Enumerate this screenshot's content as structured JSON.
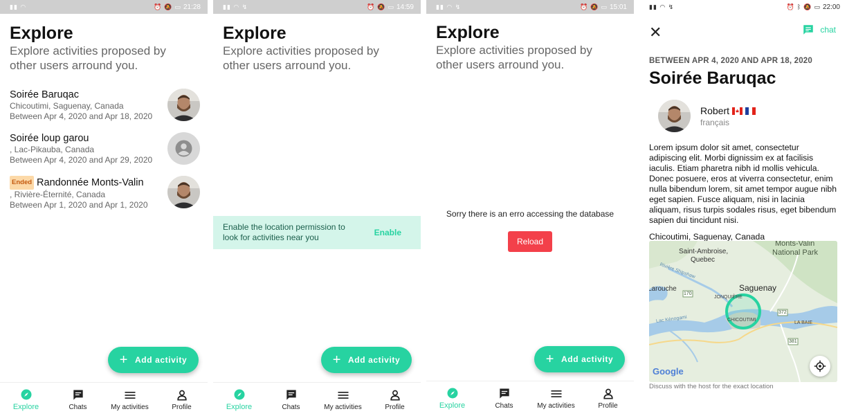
{
  "screens": [
    {
      "status_time": "21:28",
      "title": "Explore",
      "subtitle": "Explore activities proposed by other users arround you.",
      "activities": [
        {
          "name": "Soirée Baruqac",
          "location": "Chicoutimi, Saguenay, Canada",
          "dates": "Between Apr 4, 2020 and Apr 18, 2020",
          "avatar": "photo"
        },
        {
          "name": "Soirée loup garou",
          "location": ", Lac-Pikauba, Canada",
          "dates": "Between Apr 4, 2020 and Apr 29, 2020",
          "avatar": "placeholder"
        },
        {
          "badge": "Ended",
          "name": "Randonnée Monts-Valin",
          "location": ", Rivière-Éternité, Canada",
          "dates": "Between Apr 1, 2020 and Apr 1, 2020",
          "avatar": "photo"
        }
      ],
      "fab_label": "Add activity",
      "nav": [
        "Explore",
        "Chats",
        "My activities",
        "Profile"
      ]
    },
    {
      "status_time": "14:59",
      "title": "Explore",
      "subtitle": "Explore activities proposed by other users arround you.",
      "banner_text": "Enable the location permission to look for activities near you",
      "banner_action": "Enable",
      "fab_label": "Add activity",
      "nav": [
        "Explore",
        "Chats",
        "My activities",
        "Profile"
      ]
    },
    {
      "status_time": "15:01",
      "title": "Explore",
      "subtitle": "Explore activities proposed by other users arround you.",
      "error_text": "Sorry there is an erro accessing the database",
      "reload_label": "Reload",
      "fab_label": "Add activity",
      "nav": [
        "Explore",
        "Chats",
        "My activities",
        "Profile"
      ]
    },
    {
      "status_time": "22:00",
      "chat_label": "chat",
      "date_range": "BETWEEN APR 4, 2020 AND APR 18, 2020",
      "event_title": "Soirée Baruqac",
      "host_name": "Robert",
      "host_language": "français",
      "description": "Lorem ipsum dolor sit amet, consectetur adipiscing elit. Morbi dignissim ex at facilisis iaculis. Etiam pharetra nibh id mollis vehicula. Donec posuere, eros at viverra consectetur, enim nulla bibendum lorem, sit amet tempor augue nibh eget sapien. Fusce aliquam, nisi in lacinia aliquam, risus turpis sodales risus, eget bibendum sapien dui tincidunt nisi.",
      "location": "Chicoutimi, Saguenay, Canada",
      "map_labels": {
        "monts_valin": "Monts-Valin",
        "national_park": "National Park",
        "saint_ambroise": "Saint-Ambroise,",
        "quebec": "Quebec",
        "laroche": "Larouche",
        "saguenay": "Saguenay",
        "jonquiere": "JONQUIÈRE",
        "chicoutimi": "CHICOUTIMI",
        "la_baie": "LA BAIE",
        "riviere": "Rivière Shipshaw",
        "lac_kenogami": "Lac Kénogami",
        "route_170": "170",
        "route_372": "372",
        "route_381": "381",
        "google": "Google"
      },
      "map_note": "Discuss with the host for the exact location"
    }
  ]
}
